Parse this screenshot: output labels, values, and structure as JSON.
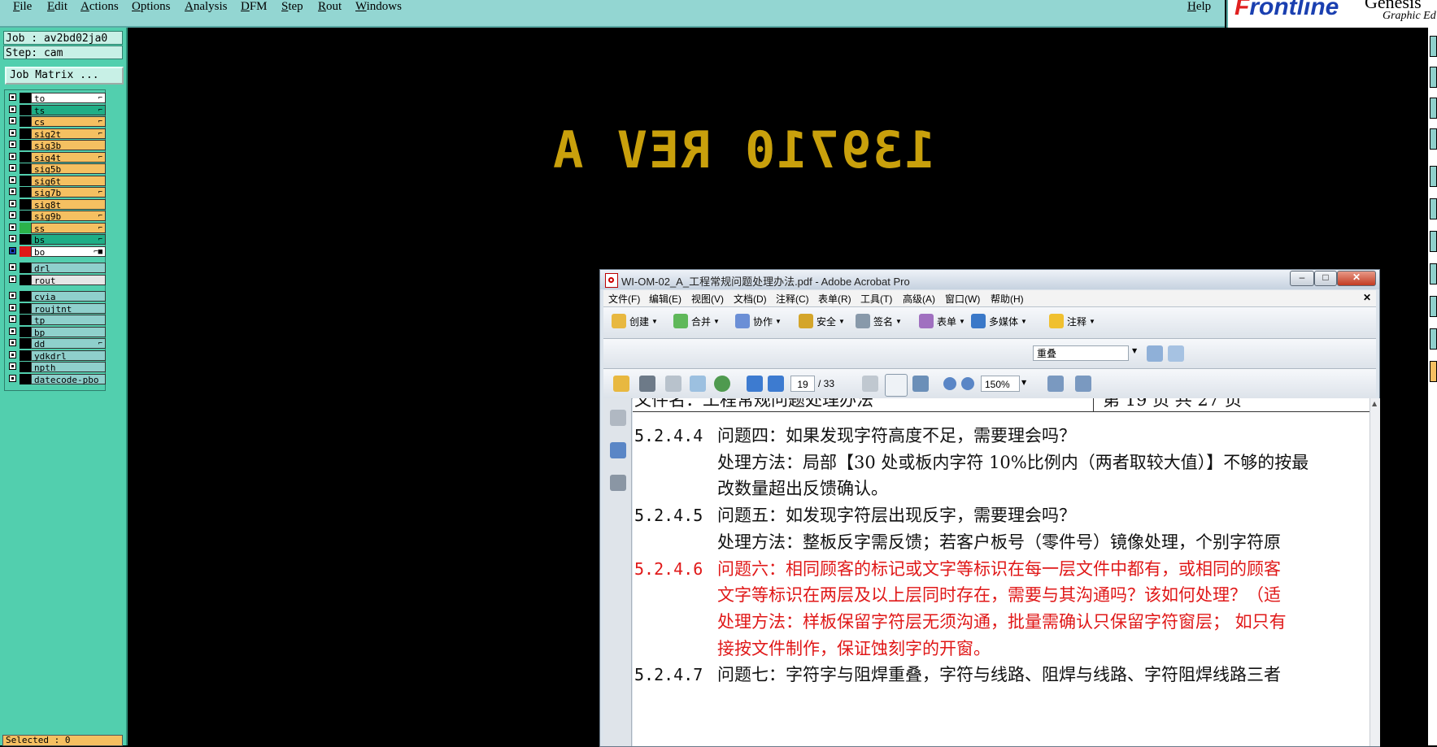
{
  "menubar": {
    "items": [
      "File",
      "Edit",
      "Actions",
      "Options",
      "Analysis",
      "DFM",
      "Step",
      "Rout",
      "Windows"
    ],
    "help": "Help"
  },
  "logo": {
    "brand": "Frontline",
    "line1": "Genesis",
    "line2": "Graphic Ed"
  },
  "left": {
    "job": "Job : av2bd02ja0",
    "step": "Step: cam",
    "job_matrix": "Job Matrix ...",
    "layers_group1": [
      {
        "name": "to",
        "color": "#ffffff",
        "swatch": "#000000",
        "mark": "⌐"
      },
      {
        "name": "ts",
        "color": "#1fae86",
        "swatch": "#000000",
        "mark": "⌐"
      },
      {
        "name": "cs",
        "color": "#f5c061",
        "swatch": "#000000",
        "mark": "⌐"
      },
      {
        "name": "sig2t",
        "color": "#f5c061",
        "swatch": "#000000",
        "mark": "⌐"
      },
      {
        "name": "sig3b",
        "color": "#f5c061",
        "swatch": "#000000",
        "mark": ""
      },
      {
        "name": "sig4t",
        "color": "#f5c061",
        "swatch": "#000000",
        "mark": "⌐"
      },
      {
        "name": "sig5b",
        "color": "#f5c061",
        "swatch": "#000000",
        "mark": ""
      },
      {
        "name": "sig6t",
        "color": "#f5c061",
        "swatch": "#000000",
        "mark": ""
      },
      {
        "name": "sig7b",
        "color": "#f5c061",
        "swatch": "#000000",
        "mark": "⌐"
      },
      {
        "name": "sig8t",
        "color": "#f5c061",
        "swatch": "#000000",
        "mark": ""
      },
      {
        "name": "sig9b",
        "color": "#f5c061",
        "swatch": "#000000",
        "mark": "⌐"
      },
      {
        "name": "ss",
        "color": "#f5c061",
        "swatch": "#2bb24a",
        "mark": "⌐"
      },
      {
        "name": "bs",
        "color": "#1fae86",
        "swatch": "#000000",
        "mark": "⌐"
      },
      {
        "name": "bo",
        "color": "#ffffff",
        "swatch": "#e01818",
        "mark": "⌐■"
      }
    ],
    "layers_group2": [
      {
        "name": "drl",
        "color": "#8fd0cc"
      },
      {
        "name": "rout",
        "color": "#e6e6e6"
      }
    ],
    "layers_group3": [
      {
        "name": "cvia",
        "color": "#8fd0cc",
        "mark": ""
      },
      {
        "name": "roujtnt",
        "color": "#8fd0cc",
        "mark": ""
      },
      {
        "name": "tp",
        "color": "#8fd0cc",
        "mark": ""
      },
      {
        "name": "bp",
        "color": "#8fd0cc",
        "mark": ""
      },
      {
        "name": "dd",
        "color": "#8fd0cc",
        "mark": "⌐"
      },
      {
        "name": "ydkdrl",
        "color": "#8fd0cc",
        "mark": ""
      },
      {
        "name": "npth",
        "color": "#8fd0cc",
        "mark": ""
      },
      {
        "name": "datecode-pbo",
        "color": "#8fd0cc",
        "mark": ""
      }
    ],
    "selected": "Selected : 0"
  },
  "canvas": {
    "mirrored_text": "139710 REV A"
  },
  "acrobat": {
    "title": "WI-OM-02_A_工程常规问题处理办法.pdf - Adobe Acrobat Pro",
    "menu": [
      "文件(F)",
      "编辑(E)",
      "视图(V)",
      "文档(D)",
      "注释(C)",
      "表单(R)",
      "工具(T)",
      "高级(A)",
      "窗口(W)",
      "帮助(H)"
    ],
    "toolbar1": [
      "创建",
      "合并",
      "协作",
      "安全",
      "签名",
      "表单",
      "多媒体",
      "注释"
    ],
    "overlay_select": "重叠",
    "page_current": "19",
    "page_total": "/ 33",
    "zoom": "150%",
    "doc_header": "文件名：工程常规问题处理办法",
    "doc_header_right": "第 19 页 共 27 页",
    "lines": [
      {
        "num": "5.2.4.4",
        "text": "问题四：如果发现字符高度不足，需要理会吗？",
        "red": false
      },
      {
        "num": "",
        "text": "处理方法：局部【30 处或板内字符 10%比例内（两者取较大值）】不够的按最",
        "red": false
      },
      {
        "num": "",
        "text": "改数量超出反馈确认。",
        "red": false
      },
      {
        "num": "5.2.4.5",
        "text": "问题五：如发现字符层出现反字，需要理会吗？",
        "red": false
      },
      {
        "num": "",
        "text": "处理方法：整板反字需反馈；若客户板号（零件号）镜像处理，个别字符原",
        "red": false
      },
      {
        "num": "5.2.4.6",
        "text": "问题六：相同顾客的标记或文字等标识在每一层文件中都有，或相同的顾客",
        "red": true
      },
      {
        "num": "",
        "text": "文字等标识在两层及以上层同时存在，需要与其沟通吗？该如何处理？（适",
        "red": true
      },
      {
        "num": "",
        "text": "处理方法：样板保留字符层无须沟通，批量需确认只保留字符窗层；  如只有",
        "red": true
      },
      {
        "num": "",
        "text": "接按文件制作，保证蚀刻字的开窗。",
        "red": true
      },
      {
        "num": "5.2.4.7",
        "text": "问题七：字符字与阻焊重叠，字符与线路、阻焊与线路、字符阻焊线路三者",
        "red": false
      }
    ]
  }
}
